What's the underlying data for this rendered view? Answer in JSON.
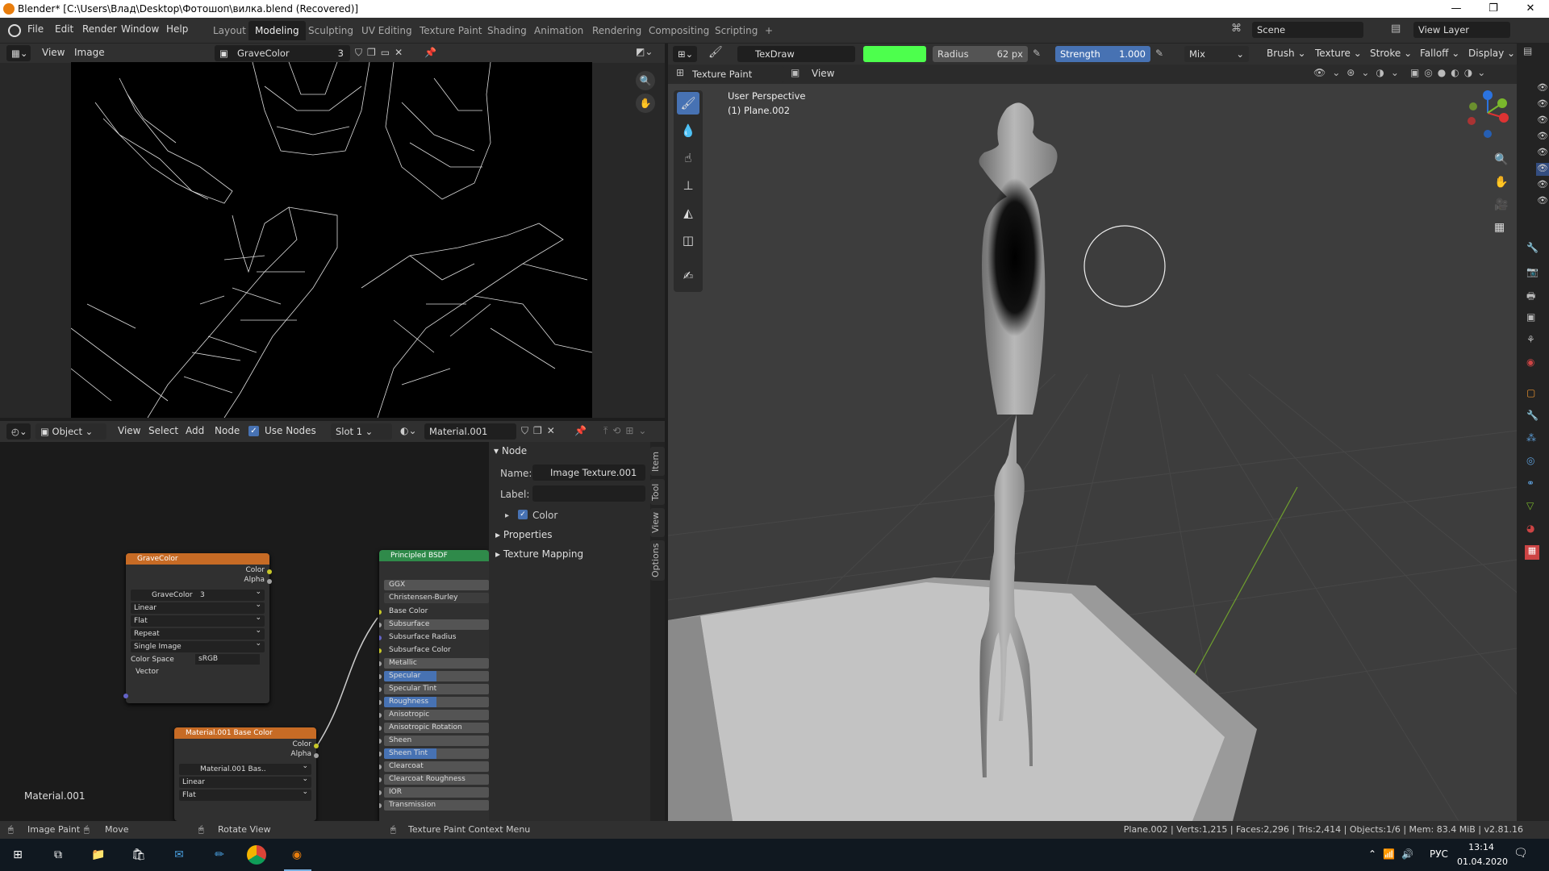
{
  "window": {
    "title": "Blender* [C:\\Users\\Влад\\Desktop\\Фотошоп\\вилка.blend (Recovered)]",
    "min": "—",
    "max": "❐",
    "close": "✕"
  },
  "menu": [
    "File",
    "Edit",
    "Render",
    "Window",
    "Help"
  ],
  "workspaces": [
    "Layout",
    "Modeling",
    "Sculpting",
    "UV Editing",
    "Texture Paint",
    "Shading",
    "Animation",
    "Rendering",
    "Compositing",
    "Scripting",
    "+"
  ],
  "active_workspace": "Modeling",
  "scene": {
    "name": "Scene",
    "view_layer": "View Layer"
  },
  "image_editor": {
    "menus": [
      "View",
      "Image"
    ],
    "image_name": "GraveColor",
    "users": "3"
  },
  "node_editor": {
    "mode": "Object",
    "menus": [
      "View",
      "Select",
      "Add",
      "Node"
    ],
    "use_nodes": "Use Nodes",
    "slot": "Slot 1",
    "material": "Material.001",
    "material_label": "Material.001",
    "image_node": {
      "title": "GraveColor",
      "out_color": "Color",
      "out_alpha": "Alpha",
      "image": "GraveColor",
      "users": "3",
      "interp": "Linear",
      "proj": "Flat",
      "ext": "Repeat",
      "source": "Single Image",
      "cs_label": "Color Space",
      "cs": "sRGB",
      "vector": "Vector"
    },
    "image_node2": {
      "title": "Material.001 Base Color",
      "out_color": "Color",
      "out_alpha": "Alpha",
      "image": "Material.001 Bas..",
      "interp": "Linear",
      "proj": "Flat"
    },
    "bsdf": {
      "title": "Principled BSDF",
      "dist": "GGX",
      "sss": "Christensen-Burley",
      "inputs": [
        "Base Color",
        "Subsurface",
        "Subsurface Radius",
        "Subsurface Color",
        "Metallic",
        "Specular",
        "Specular Tint",
        "Roughness",
        "Anisotropic",
        "Anisotropic Rotation",
        "Sheen",
        "Sheen Tint",
        "Clearcoat",
        "Clearcoat Roughness",
        "IOR",
        "Transmission"
      ]
    },
    "panel": {
      "section": "Node",
      "name_label": "Name:",
      "name_value": "Image Texture.001",
      "label_label": "Label:",
      "color": "Color",
      "properties": "Properties",
      "texture_mapping": "Texture Mapping"
    },
    "tabs": [
      "Item",
      "Tool",
      "View",
      "Options"
    ]
  },
  "viewport": {
    "brush": "TexDraw",
    "brush_color": "#4dff4d",
    "radius_label": "Radius",
    "radius_value": "62 px",
    "strength_label": "Strength",
    "strength_value": "1.000",
    "blend": "Mix",
    "menus": [
      "Brush",
      "Texture",
      "Stroke",
      "Falloff",
      "Display"
    ],
    "mode": "Texture Paint",
    "view": "View",
    "overlay_line1": "User Perspective",
    "overlay_line2": "(1) Plane.002"
  },
  "status": {
    "left1": "Image Paint",
    "left2": "Move",
    "left3": "Rotate View",
    "center": "Texture Paint Context Menu",
    "right": "Plane.002 | Verts:1,215 | Faces:2,296 | Tris:2,414 | Objects:1/6 | Mem: 83.4 MiB | v2.81.16"
  },
  "taskbar": {
    "lang": "РУС",
    "time": "13:14",
    "date": "01.04.2020"
  }
}
